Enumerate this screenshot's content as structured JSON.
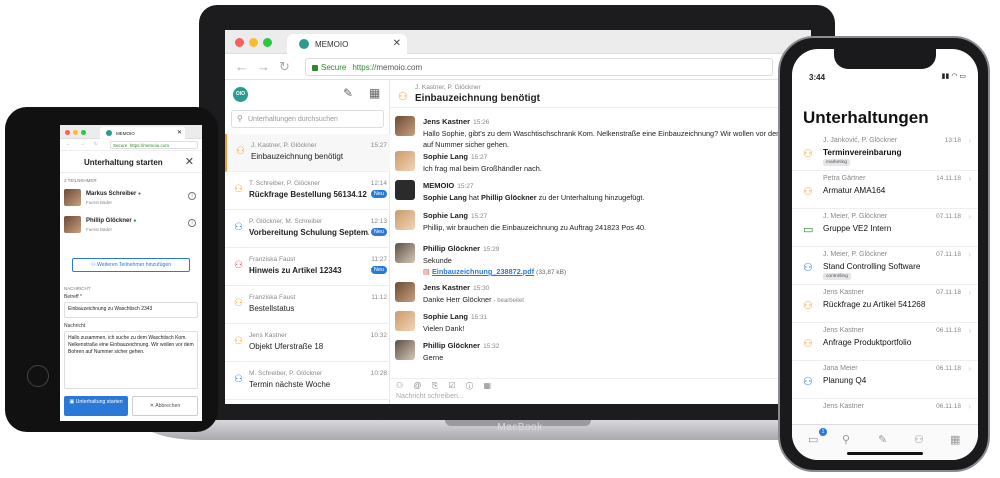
{
  "colors": {
    "accent": "#2b79d6",
    "brand": "#2b9b8f",
    "warning": "#f0a030",
    "secure": "#2c8a2c"
  },
  "macbook": {
    "label": "MacBook",
    "tab_title": "MEMOIO",
    "secure_label": "Secure",
    "url_scheme": "https://",
    "url_host": "memoio.com",
    "sidebar": {
      "logo_text": "OIO",
      "search_placeholder": "Unterhaltungen durchsuchen",
      "conversations": [
        {
          "who": "J. Kastner, P. Glöckner",
          "title": "Einbauzeichnung benötigt",
          "time": "15:27",
          "icon": "person-orange-icon",
          "active": true,
          "bold": false,
          "badge": ""
        },
        {
          "who": "T. Schreiber, P. Glöckner",
          "title": "Rückfrage Bestellung 56134.12",
          "time": "12:14",
          "icon": "person-orange-icon",
          "bold": true,
          "badge": "Neu"
        },
        {
          "who": "P. Glöckner, M. Schreiber",
          "title": "Vorbereitung Schulung Septem...",
          "time": "12:13",
          "icon": "group-blue-icon",
          "bold": true,
          "badge": "Neu"
        },
        {
          "who": "Franziska Faust",
          "title": "Hinweis zu Artikel 12343",
          "time": "11:27",
          "icon": "person-red-icon",
          "bold": true,
          "badge": "Neu"
        },
        {
          "who": "Franziska Faust",
          "title": "Bestellstatus",
          "time": "11:12",
          "icon": "person-orange-icon",
          "bold": false,
          "badge": ""
        },
        {
          "who": "Jens Kastner",
          "title": "Objekt Uferstraße 18",
          "time": "10:32",
          "icon": "person-orange-icon",
          "bold": false,
          "badge": ""
        },
        {
          "who": "M. Schreiber, P. Glöckner",
          "title": "Termin nächste Woche",
          "time": "10:28",
          "icon": "group-blue-icon",
          "bold": false,
          "badge": ""
        }
      ]
    },
    "chat": {
      "who": "J. Kastner, P. Glöckner",
      "title": "Einbauzeichnung benötigt",
      "messages": [
        {
          "name": "Jens Kastner",
          "time": "15:26",
          "text": "Hallo Sophie, gibt's zu dem Waschtischschrank Kom. Nelkenstraße eine Einbauzeichnung? Wir wollen vor dem Bohren auf Nummer sicher gehen."
        },
        {
          "name": "Sophie Lang",
          "time": "15:27",
          "text": "Ich frag mal beim Großhändler nach."
        },
        {
          "name": "MEMOIO",
          "time": "15:27",
          "text_pre": "Sophie Lang",
          "text_mid": " hat ",
          "text_user": "Phillip Glöckner",
          "text_post": " zu der Unterhaltung hinzugefügt."
        },
        {
          "name": "Sophie Lang",
          "time": "15:27",
          "text": "Phillip, wir brauchen die Einbauzeichnung zu Auftrag 241823 Pos 40."
        },
        {
          "name": "Phillip Glöckner",
          "time": "15:29",
          "text": "Sekunde",
          "file": "Einbauzeichnung_238872.pdf",
          "file_size": "(33,87 kB)"
        },
        {
          "name": "Jens Kastner",
          "time": "15:30",
          "text": "Danke Herr Glöckner",
          "edited": "- bearbeitet"
        },
        {
          "name": "Sophie Lang",
          "time": "15:31",
          "text": "Vielen Dank!"
        },
        {
          "name": "Phillip Glöckner",
          "time": "15:32",
          "text": "Gerne"
        }
      ],
      "composer_placeholder": "Nachricht schreiben..."
    }
  },
  "ipad": {
    "tab_title": "MEMOIO",
    "secure_label": "Secure",
    "url": "https://memoio.com",
    "title": "Unterhaltung starten",
    "participants_label": "2 TEILNEHMER",
    "participants": [
      {
        "name": "Markus Schreiber",
        "role": "Fuerst Bäder",
        "online": "●"
      },
      {
        "name": "Phillip Glöckner",
        "role": "Fuerst Bäder",
        "online": "●"
      }
    ],
    "add_button": "Weiteren Teilnehmer hinzufügen",
    "nachricht_section": "NACHRICHT",
    "betreff_label": "Betreff *",
    "betreff_value": "Einbauzeichnung zu Waschtisch 2343",
    "nachricht_label": "Nachricht",
    "nachricht_value": "Hallo zusammen, ich suche zu dem Waschtisch Kom. Nelkenstraße eine Einbauzeichnung. Wir wollen vor dem Bohren auf Nummer sicher gehen.",
    "start_button": "Unterhaltung starten",
    "cancel_button": "Abbrechen"
  },
  "iphone": {
    "time": "3:44",
    "title": "Unterhaltungen",
    "items": [
      {
        "who": "J. Janković, P. Glöckner",
        "title": "Terminvereinbarung",
        "time": "13:18",
        "bold": true,
        "tag": "marketing",
        "icon": "group-orange-icon"
      },
      {
        "who": "Petra Gärtner",
        "title": "Armatur AMA164",
        "time": "14.11.18",
        "bold": false,
        "tag": "",
        "icon": "person-orange-icon"
      },
      {
        "who": "J. Meier, P. Glöckner",
        "title": "Gruppe VE2 Intern",
        "time": "07.11.18",
        "bold": false,
        "tag": "",
        "icon": "chat-green-icon"
      },
      {
        "who": "J. Meier, P. Glöckner",
        "title": "Stand Controlling Software",
        "time": "07.11.18",
        "bold": false,
        "tag": "controlling",
        "icon": "group-blue-icon"
      },
      {
        "who": "Jens Kastner",
        "title": "Rückfrage zu Artikel 541268",
        "time": "07.11.18",
        "bold": false,
        "tag": "",
        "icon": "person-orange-icon"
      },
      {
        "who": "Jens Kastner",
        "title": "Anfrage Produktportfolio",
        "time": "06.11.18",
        "bold": false,
        "tag": "",
        "icon": "person-orange-icon"
      },
      {
        "who": "Jana Meier",
        "title": "Planung Q4",
        "time": "06.11.18",
        "bold": false,
        "tag": "",
        "icon": "person-blue-icon"
      },
      {
        "who": "Jens Kastner",
        "title": "",
        "time": "06.11.18",
        "bold": false,
        "tag": "",
        "icon": ""
      }
    ],
    "badge_count": "1"
  }
}
